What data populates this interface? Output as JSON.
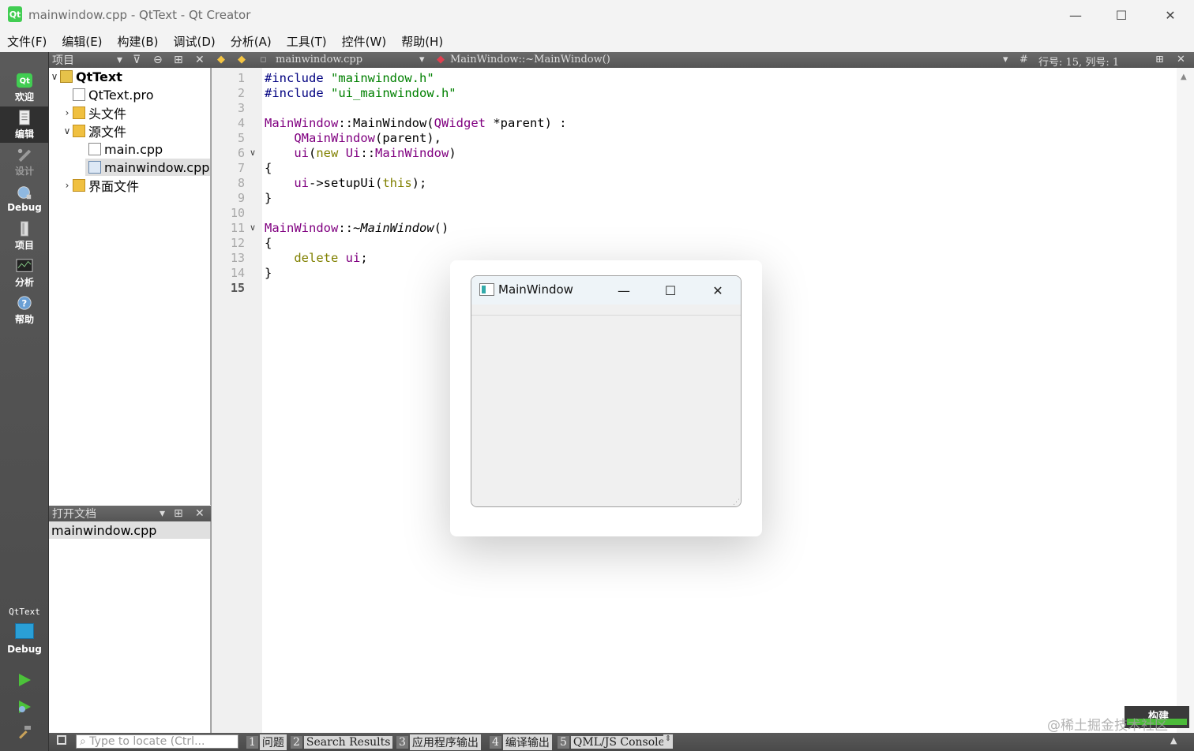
{
  "window": {
    "title": "mainwindow.cpp - QtText - Qt Creator",
    "app_icon_text": "Qt",
    "controls": {
      "minimize": "—",
      "maximize": "☐",
      "close": "✕"
    }
  },
  "menubar": [
    "文件(F)",
    "编辑(E)",
    "构建(B)",
    "调试(D)",
    "分析(A)",
    "工具(T)",
    "控件(W)",
    "帮助(H)"
  ],
  "modes": [
    {
      "label": "欢迎",
      "icon": "qt-logo-icon"
    },
    {
      "label": "编辑",
      "icon": "edit-icon"
    },
    {
      "label": "设计",
      "icon": "design-icon"
    },
    {
      "label": "Debug",
      "icon": "debug-icon"
    },
    {
      "label": "项目",
      "icon": "projects-icon"
    },
    {
      "label": "分析",
      "icon": "analyze-icon"
    },
    {
      "label": "帮助",
      "icon": "help-icon"
    }
  ],
  "kit": {
    "project": "QtText",
    "config": "Debug"
  },
  "project_panel": {
    "title": "项目",
    "tree": [
      {
        "label": "QtText",
        "expanded": true
      },
      {
        "label": "QtText.pro"
      },
      {
        "label": "头文件",
        "expanded": false
      },
      {
        "label": "源文件",
        "expanded": true
      },
      {
        "label": "main.cpp"
      },
      {
        "label": "mainwindow.cpp",
        "selected": true
      },
      {
        "label": "界面文件",
        "expanded": false
      }
    ]
  },
  "open_documents": {
    "title": "打开文档",
    "items": [
      "mainwindow.cpp"
    ]
  },
  "editor_toolbar": {
    "file": "mainwindow.cpp",
    "symbol": "MainWindow::~MainWindow()",
    "hash": "#",
    "position": "行号: 15, 列号: 1"
  },
  "editor": {
    "current_line": 15,
    "lines": [
      "#include \"mainwindow.h\"",
      "#include \"ui_mainwindow.h\"",
      "",
      "MainWindow::MainWindow(QWidget *parent) :",
      "    QMainWindow(parent),",
      "    ui(new Ui::MainWindow)",
      "{",
      "    ui->setupUi(this);",
      "}",
      "",
      "MainWindow::~MainWindow()",
      "{",
      "    delete ui;",
      "}",
      ""
    ]
  },
  "floating_window": {
    "title": "MainWindow"
  },
  "statusbar": {
    "locate_placeholder": "Type to locate (Ctrl...",
    "tabs": [
      {
        "num": "1",
        "label": "问题"
      },
      {
        "num": "2",
        "label": "Search Results"
      },
      {
        "num": "3",
        "label": "应用程序输出"
      },
      {
        "num": "4",
        "label": "编译输出"
      },
      {
        "num": "5",
        "label": "QML/JS Console"
      }
    ]
  },
  "build_progress": {
    "label": "构建",
    "fraction": 1.0
  },
  "watermark": "@稀土掘金技术社区",
  "colors": {
    "preprocessor": "#000080",
    "string": "#008000",
    "keyword": "#808000",
    "class": "#800080",
    "sidebar": "#4f4f4f"
  }
}
